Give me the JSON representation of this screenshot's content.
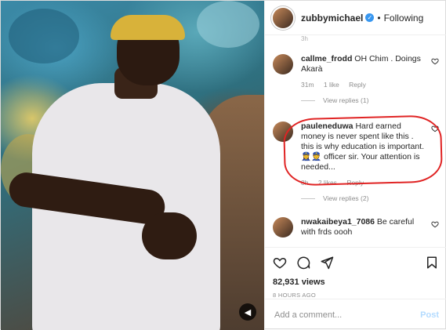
{
  "header": {
    "username": "zubbymichael",
    "separator": "•",
    "follow_state": "Following"
  },
  "scroll_fragment": "3h",
  "comments": [
    {
      "user": "callme_frodd",
      "text": "OH Chim . Doings Akarà",
      "time": "31m",
      "likes": "1 like",
      "reply": "Reply",
      "view_replies": "View replies (1)"
    },
    {
      "user": "pauleneduwa",
      "text": "Hard earned money is never spent like this . this is why education is important. 👮‍♀️👮 officer sir. Your attention is needed...",
      "time": "8h",
      "likes": "2 likes",
      "reply": "Reply",
      "view_replies": "View replies (2)"
    },
    {
      "user": "nwakaibeya1_7086",
      "text": "Be careful with frds oooh"
    }
  ],
  "icons": {
    "like": "heart-icon",
    "comment": "comment-icon",
    "share": "share-icon",
    "save": "bookmark-icon"
  },
  "stats": {
    "views": "82,931 views",
    "age": "8 HOURS AGO"
  },
  "add_comment": {
    "placeholder": "Add a comment...",
    "post_label": "Post"
  },
  "colors": {
    "verified": "#3897f0",
    "highlight": "#e02424",
    "post_disabled": "#b3dbff"
  }
}
